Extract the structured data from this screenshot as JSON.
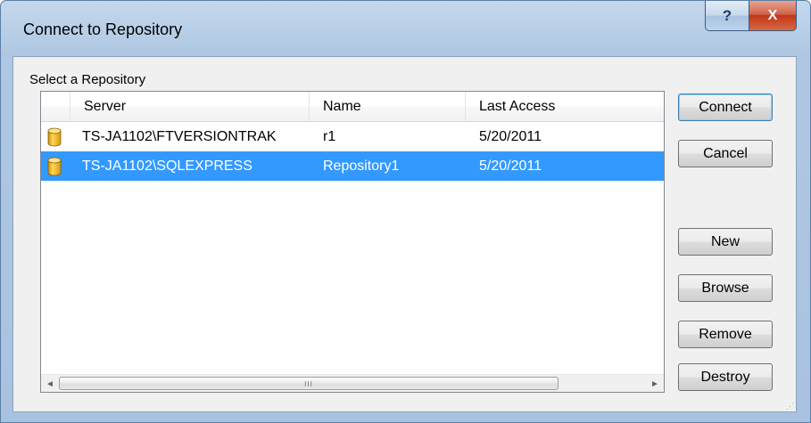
{
  "window": {
    "title": "Connect to Repository",
    "help_label": "?",
    "close_label": "X"
  },
  "group": {
    "label": "Select a Repository"
  },
  "list": {
    "columns": [
      "Server",
      "Name",
      "Last Access"
    ],
    "rows": [
      {
        "server": "TS-JA1102\\FTVERSIONTRAK",
        "name": "r1",
        "last_access": "5/20/2011",
        "selected": false,
        "icon": "database-icon"
      },
      {
        "server": "TS-JA1102\\SQLEXPRESS",
        "name": "Repository1",
        "last_access": "5/20/2011",
        "selected": true,
        "icon": "database-icon"
      }
    ],
    "scroll_left": "◄",
    "scroll_right": "►",
    "scroll_grip": "III"
  },
  "buttons": {
    "connect": "Connect",
    "cancel": "Cancel",
    "new": "New",
    "browse": "Browse",
    "remove": "Remove",
    "destroy": "Destroy"
  },
  "colors": {
    "selection": "#3399ff",
    "close_button": "#c2371a",
    "title_bar": "#bad0e8"
  }
}
